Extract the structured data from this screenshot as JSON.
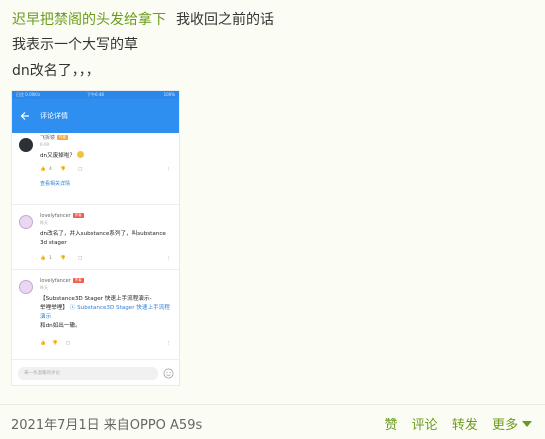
{
  "post": {
    "author": "迟早把禁阁的头发给拿下",
    "line1": "我收回之前的话",
    "line2": "我表示一个大写的草",
    "line3": "dn改名了，，，"
  },
  "screenshot": {
    "status_left": "已注 0.00K/s",
    "status_time": "下午6:48",
    "status_right": "100%",
    "title": "评论详情",
    "comments": [
      {
        "name": "飞拆镜",
        "tag": "作者",
        "time": "6-09",
        "text": "dn又废掉啦？",
        "likes": "4",
        "view_link": "查看相关详情"
      },
      {
        "name": "lovelyfancer",
        "tag": "作者",
        "time": "昨天",
        "text": "dn改名了，并入substance系列了，叫substance 3d stager",
        "likes": "1"
      },
      {
        "name": "lovelyfancer",
        "tag": "作者",
        "time": "昨天",
        "text_a": "【Substance3D Stager 快速上手流程演示-",
        "text_b": "举哩举哩】",
        "link": "Substance3D Stager 快速上手流程演示",
        "text_c": "和dn如出一辙。"
      }
    ],
    "input_placeholder": "来一条温暖的评论"
  },
  "footer": {
    "date_source": "2021年7月1日   来自OPPO A59s",
    "like": "赞",
    "comment": "评论",
    "forward": "转发",
    "more": "更多"
  },
  "colors": {
    "accent": "#6b9b1e",
    "app_blue": "#2f8ff0",
    "background": "#fbfdf4"
  }
}
